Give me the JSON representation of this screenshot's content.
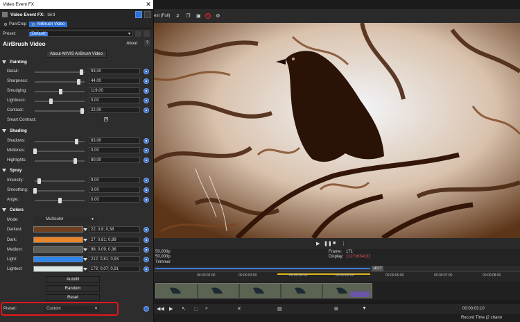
{
  "window": {
    "title": "Video Event FX",
    "close_glyph": "✕"
  },
  "fx_header": {
    "label": "Video Event FX:",
    "value": "bird"
  },
  "chain": {
    "items": [
      {
        "label": "Pan/Crop"
      },
      {
        "label": "AirBrush Video"
      }
    ]
  },
  "preset": {
    "label": "Preset:",
    "value": "(Default)"
  },
  "plugin": {
    "name": "AirBrush Video",
    "about": "About",
    "help": "?",
    "about_button": "About AKVIS AirBrush Video"
  },
  "sections": {
    "painting": "Painting",
    "shading": "Shading",
    "spray": "Spray",
    "colors": "Colors"
  },
  "params": {
    "detail": {
      "label": "Detail:",
      "value": "93,00",
      "level": 0.93
    },
    "sharpness": {
      "label": "Sharpness:",
      "value": "44,00",
      "level": 0.88
    },
    "smudging": {
      "label": "Smudging:",
      "value": "119,00",
      "level": 0.52
    },
    "lightness": {
      "label": "Lightness:",
      "value": "0,00",
      "level": 0.32
    },
    "contrast": {
      "label": "Contrast:",
      "value": "22,00",
      "level": 0.95
    },
    "smart_contrast": {
      "label": "Smart Contrast:",
      "checked": "✕"
    },
    "shadows": {
      "label": "Shadows:",
      "value": "83,00",
      "level": 0.83
    },
    "midtones": {
      "label": "Midtones:",
      "value": "0,00",
      "level": 0.0
    },
    "highlights": {
      "label": "Highlights:",
      "value": "80,00",
      "level": 0.8
    },
    "intensity": {
      "label": "Intensity:",
      "value": "9,00",
      "level": 0.09
    },
    "smoothing": {
      "label": "Smoothing:",
      "value": "0,00",
      "level": 0.0
    },
    "angle": {
      "label": "Angle:",
      "value": "0,00",
      "level": 0.5
    }
  },
  "colors": {
    "mode_label": "Mode:",
    "mode_value": "Multicolor",
    "items": [
      {
        "label": "Darkest:",
        "value": "22; 0,8; 0,38",
        "color": "#6e4020"
      },
      {
        "label": "Dark:",
        "value": "27; 0,81; 0,89",
        "color": "#e8842a"
      },
      {
        "label": "Medium:",
        "value": "98; 0,09; 0,36",
        "color": "#5a5d54"
      },
      {
        "label": "Light:",
        "value": "212; 0,81; 0,93",
        "color": "#2e86ec"
      },
      {
        "label": "Lightest:",
        "value": "173; 0,07; 0,91",
        "color": "#dce8e6"
      }
    ]
  },
  "actions": {
    "autofill": "Autofill",
    "random": "Random",
    "reset": "Reset"
  },
  "bottom_preset": {
    "label": "Preset:",
    "value": "Custom"
  },
  "preview_toolbar": {
    "mode": "est (Full)"
  },
  "info": {
    "line1": "50,000p",
    "line2": "50,000p",
    "line3": "Trimmer",
    "frame_label": "Frame:",
    "frame_value": "171",
    "display_label": "Display:",
    "display_value": "1127x634x32"
  },
  "timeline": {
    "marker": "+6:17",
    "ticks": [
      "00:00:02:00",
      "00:00:03:00",
      "00:00:04:00",
      "00:00:05:00",
      "00:00:06:00",
      "00:00:07:00",
      "00:00:08:00"
    ],
    "timecode": "00:00:03:10",
    "status": "Record Time (2 chann"
  },
  "accent": {
    "blue": "#2f6fd6",
    "highlight_red": "#e3151b"
  }
}
